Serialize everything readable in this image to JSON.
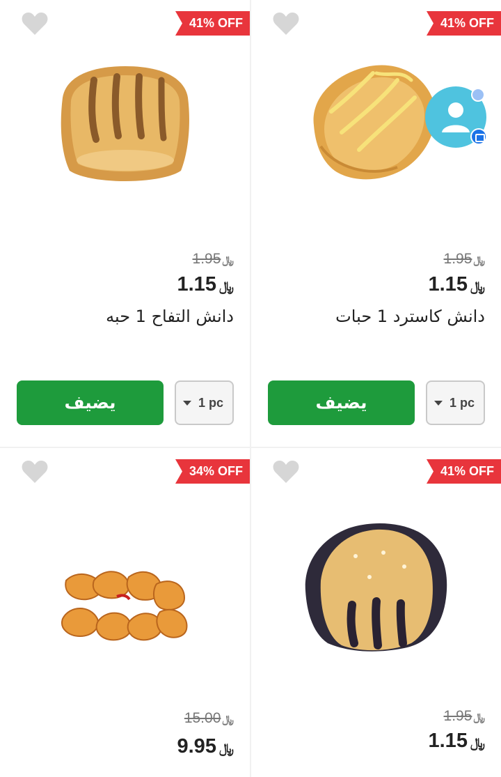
{
  "products": [
    {
      "discount": "41% OFF",
      "old_price": "1.95",
      "price": "1.15",
      "currency": "﷼",
      "name": "دانش كاسترد 1 حبات",
      "qty": "1 pc",
      "add_label": "يضيف",
      "image": "custard-danish"
    },
    {
      "discount": "41% OFF",
      "old_price": "1.95",
      "price": "1.15",
      "currency": "﷼",
      "name": "دانش التفاح 1 حبه",
      "qty": "1 pc",
      "add_label": "يضيف",
      "image": "apple-danish"
    },
    {
      "discount": "41% OFF",
      "old_price": "1.95",
      "price": "1.15",
      "currency": "﷼",
      "image": "blueberry-danish"
    },
    {
      "discount": "34% OFF",
      "old_price": "15.00",
      "price": "9.95",
      "currency": "﷼",
      "image": "mini-croissants"
    }
  ],
  "colors": {
    "badge": "#e8353c",
    "add_button": "#1e9b3c",
    "assistant": "#4fc3df"
  },
  "icons": [
    "heart-icon",
    "chevron-down-icon",
    "user-icon",
    "chat-icon"
  ]
}
